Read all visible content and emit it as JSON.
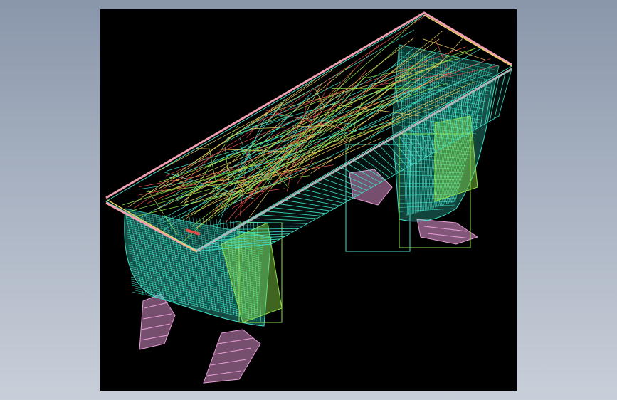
{
  "colors": {
    "background_top": "#8a96aa",
    "background_bottom": "#c9cfd9",
    "viewport": "#000000",
    "wire_cyan": "#3fe0c8",
    "wire_green": "#8ee04a",
    "wire_red": "#e0504a",
    "wire_yellow": "#e8d060",
    "wire_pink": "#e8a0d8",
    "rim_pink": "#f0a0b0"
  },
  "scene": {
    "icon": "wireframe-3d-model-icon",
    "description_visible_text": ""
  }
}
